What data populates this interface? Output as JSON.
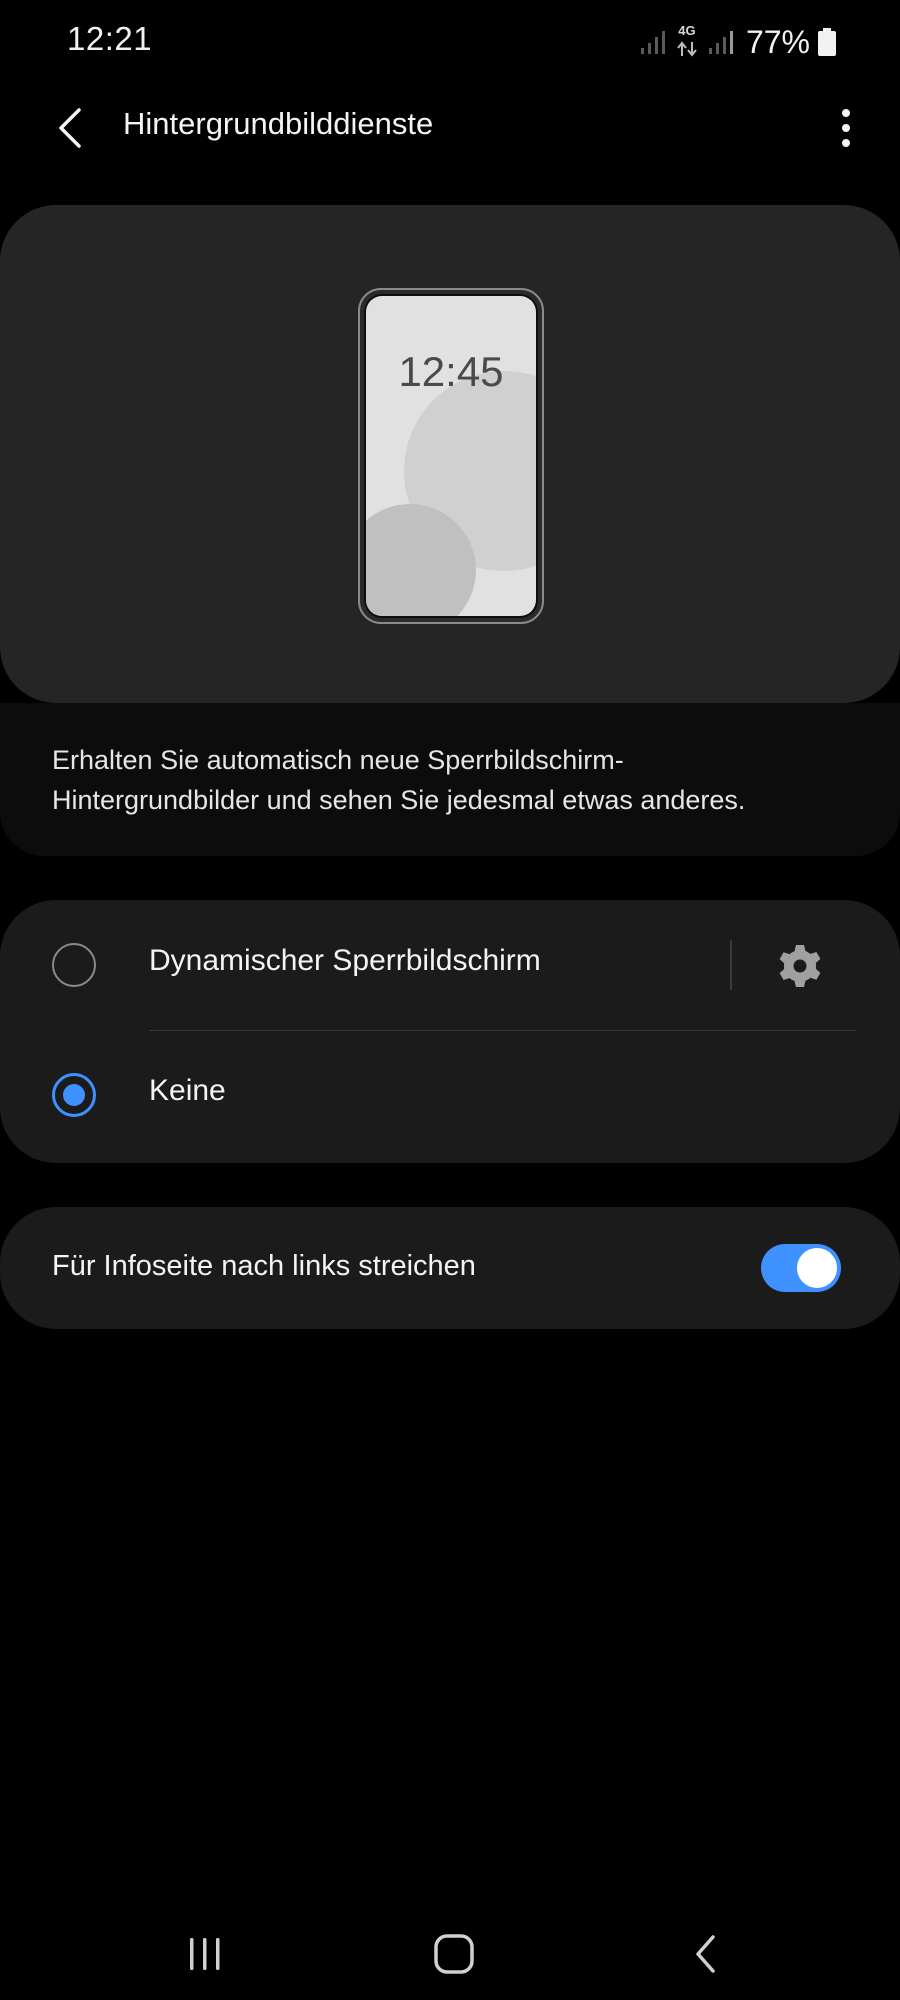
{
  "status_bar": {
    "time": "12:21",
    "network_type": "4G",
    "battery_percent": "77%",
    "icons": [
      "signal-icon",
      "network-4g-icon",
      "signal-icon",
      "battery-icon"
    ]
  },
  "header": {
    "back_icon": "chevron-left-icon",
    "title": "Hintergrundbilddienste",
    "more_icon": "more-vertical-icon"
  },
  "preview": {
    "clock": "12:45",
    "screen_color": "#e1e1e1",
    "shape_colors": [
      "#d0d0d0",
      "#c0c0c0"
    ]
  },
  "description": {
    "text": "Erhalten Sie automatisch neue Sperrbildschirm-Hintergrundbilder und sehen Sie jedesmal etwas anderes."
  },
  "options": [
    {
      "label": "Dynamischer Sperrbildschirm",
      "selected": false,
      "settings_icon": "gear-icon"
    },
    {
      "label": "Keine",
      "selected": true
    }
  ],
  "swipe_setting": {
    "label": "Für Infoseite nach links streichen",
    "enabled": true
  },
  "nav_bar": {
    "icons": [
      "recents-icon",
      "home-icon",
      "back-icon"
    ]
  },
  "colors": {
    "accent": "#3e91ff",
    "background": "#000000",
    "card": "#1b1b1b",
    "preview_card": "#252525"
  }
}
